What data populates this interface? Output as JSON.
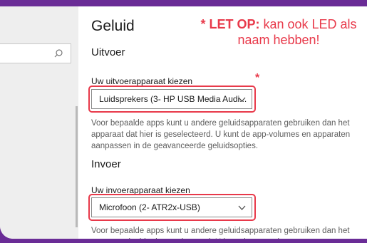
{
  "app": {
    "title": "Geluid"
  },
  "note": {
    "prefix": "* LET OP:",
    "text": "kan ook LED als naam hebben!",
    "asterisk": "*"
  },
  "colors": {
    "accent": "#e8394a",
    "background": "#6a2c96"
  },
  "search": {
    "icon": "search-icon"
  },
  "output": {
    "section_title": "Uitvoer",
    "label": "Uw uitvoerapparaat kiezen",
    "selected": "Luidsprekers (3- HP USB Media Audi...",
    "description": "Voor bepaalde apps kunt u andere geluidsapparaten gebruiken dan het apparaat dat hier is geselecteerd. U kunt de app-volumes en apparaten aanpassen in de geavanceerde geluidsopties."
  },
  "input": {
    "section_title": "Invoer",
    "label": "Uw invoerapparaat kiezen",
    "selected": "Microfoon (2- ATR2x-USB)",
    "description": "Voor bepaalde apps kunt u andere geluidsapparaten gebruiken dan het apparaat dat hier is geselecteerd. U kunt de app-volumes en apparaten"
  }
}
